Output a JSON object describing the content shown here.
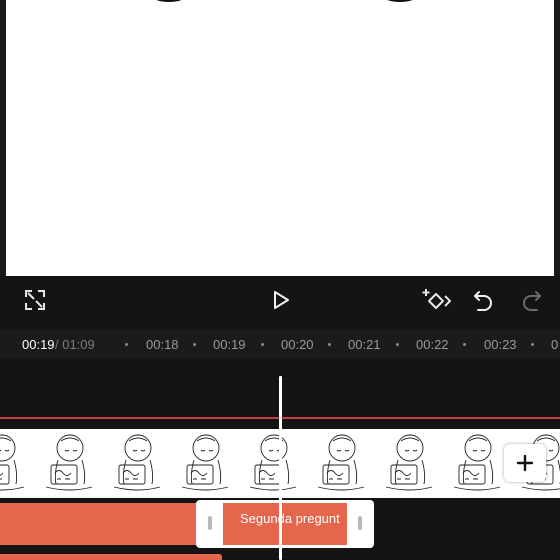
{
  "editor": {
    "current_time": "00:19",
    "total_time": "/ 01:09"
  },
  "ruler": {
    "ticks": [
      "00:18",
      "00:19",
      "00:20",
      "00:21",
      "00:22",
      "00:23",
      "0"
    ]
  },
  "controls": {
    "fullscreen_icon": "expand-icon",
    "play_icon": "play-icon",
    "keyframe_icon": "keyframe-add-icon",
    "undo_icon": "undo-icon",
    "redo_icon": "redo-icon"
  },
  "tracks": {
    "add_clip_icon": "plus-icon",
    "text_clip_label": "Segunda pregunt"
  },
  "colors": {
    "background": "#141414",
    "text_clip": "#e4664d",
    "marker_line": "#c83c47",
    "playhead": "#ffffff"
  }
}
